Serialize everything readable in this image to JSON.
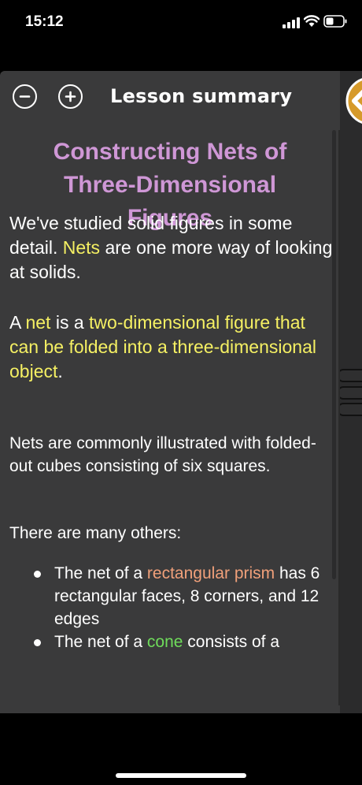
{
  "status_bar": {
    "time": "15:12"
  },
  "header": {
    "title": "Lesson summary"
  },
  "lesson": {
    "title_lines": [
      "Constructing Nets of",
      "Three-Dimensional",
      "Figures"
    ],
    "p1": {
      "a": "We've studied solid figures in some detail. ",
      "b": "Nets",
      "c": " are one more way of looking at solids."
    },
    "p2": {
      "a": "A ",
      "b": "net",
      "c": " is a ",
      "d": "two-dimensional figure that can be folded into a three-dimensional object",
      "e": "."
    },
    "p3": "Nets are commonly illustrated with folded-out cubes consisting of six squares.",
    "p4": "There are many others:",
    "bullets": [
      {
        "a": "The net of a ",
        "b": "rectangular prism",
        "c": " has 6 rectangular faces, 8 corners, and 12 edges"
      },
      {
        "a": "The net of a ",
        "b": "cone",
        "c": " consists of a"
      }
    ]
  },
  "colors": {
    "title": "#cf97d6",
    "highlight": "#f5f063",
    "term_salmon": "#f0a07a",
    "term_green": "#6fdc5b",
    "panel": "#3a3a3b"
  }
}
